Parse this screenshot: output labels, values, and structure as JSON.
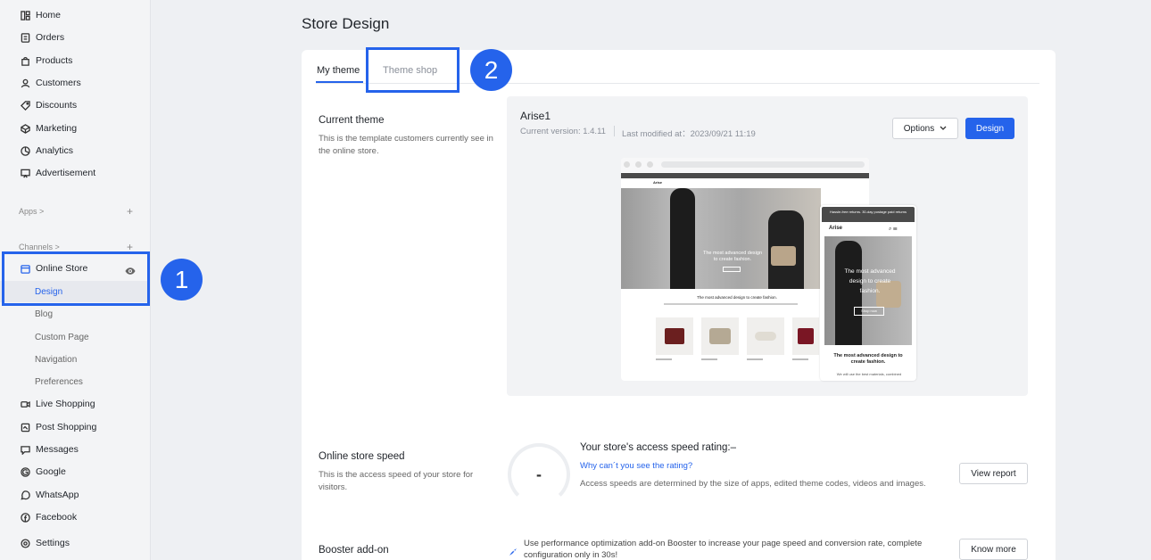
{
  "sidebar": {
    "items": [
      {
        "label": "Home",
        "icon": "home-icon"
      },
      {
        "label": "Orders",
        "icon": "orders-icon"
      },
      {
        "label": "Products",
        "icon": "products-icon"
      },
      {
        "label": "Customers",
        "icon": "customers-icon"
      },
      {
        "label": "Discounts",
        "icon": "discounts-icon"
      },
      {
        "label": "Marketing",
        "icon": "marketing-icon"
      },
      {
        "label": "Analytics",
        "icon": "analytics-icon"
      },
      {
        "label": "Advertisement",
        "icon": "advertisement-icon"
      }
    ],
    "apps_label": "Apps >",
    "channels_label": "Channels >",
    "online_store": "Online Store",
    "sub_items": [
      "Design",
      "Blog",
      "Custom Page",
      "Navigation",
      "Preferences"
    ],
    "channels": [
      {
        "label": "Live Shopping",
        "icon": "live-shopping-icon"
      },
      {
        "label": "Post Shopping",
        "icon": "post-shopping-icon"
      },
      {
        "label": "Messages",
        "icon": "messages-icon"
      },
      {
        "label": "Google",
        "icon": "google-icon"
      },
      {
        "label": "WhatsApp",
        "icon": "whatsapp-icon"
      },
      {
        "label": "Facebook",
        "icon": "facebook-icon"
      }
    ],
    "settings": "Settings"
  },
  "annotations": {
    "one": "1",
    "two": "2"
  },
  "page": {
    "title": "Store Design",
    "tabs": [
      "My theme",
      "Theme shop"
    ]
  },
  "current_theme": {
    "title": "Current theme",
    "desc": "This is the template customers currently see in the online store.",
    "name": "Arise1",
    "version": "Current version: 1.4.11",
    "modified": "Last modified at：2023/09/21 11:19",
    "options_label": "Options",
    "design_label": "Design"
  },
  "preview": {
    "brand": "Arise",
    "hero_text": "The most advanced design to create fashion.",
    "section_text": "The most advanced design to create fashion.",
    "mobile_banner": "Hassle-free returns. 30-day postage paid returns",
    "mobile_hero": "The most advanced design to create fashion.",
    "mobile_btn": "Shop now",
    "mobile_section": "The most advanced design to create fashion.",
    "mobile_sub": "We will use the best materials, combined"
  },
  "speed": {
    "title": "Online store speed",
    "desc": "This is the access speed of your store for visitors.",
    "gauge_value": "-",
    "rating": "Your store's access speed rating:–",
    "why": "Why can´t you see the rating?",
    "note": "Access speeds are determined by the size of apps, edited theme codes, videos and images.",
    "report_label": "View report"
  },
  "booster": {
    "title": "Booster add-on",
    "text": "Use performance optimization add-on Booster to increase your page speed and conversion rate, complete configuration only in 30s!",
    "btn_label": "Know more"
  },
  "colors": {
    "accent": "#2563eb"
  }
}
